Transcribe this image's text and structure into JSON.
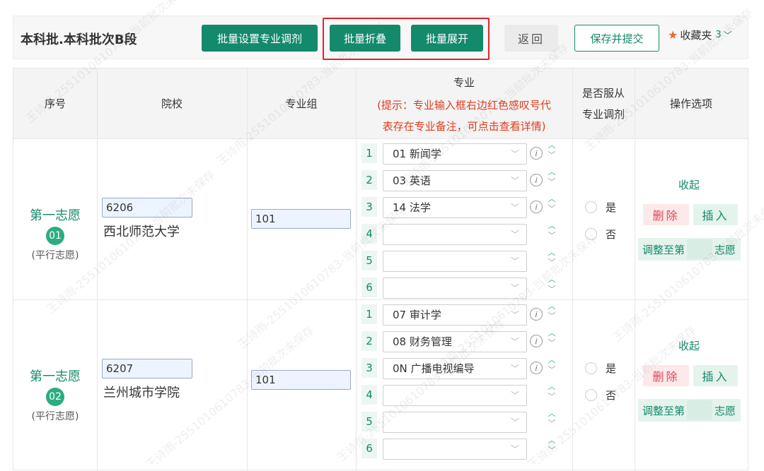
{
  "header": {
    "title": "本科批.本科批次B段",
    "batch_adjust": "批量设置专业调剂",
    "batch_collapse": "批量折叠",
    "batch_expand": "批量展开",
    "back": "返回",
    "save_submit": "保存并提交",
    "favorites": "收藏夹",
    "favorites_count": "3"
  },
  "columns": {
    "seq": "序号",
    "school": "院校",
    "group": "专业组",
    "major": "专业",
    "major_hint": "(提示：专业输入框右边红色感叹号代表存在专业备注，可点击查看详情)",
    "major_hint_line1": "(提示：专业输入框右边红色感叹号代",
    "major_hint_line2": "表存在专业备注，可点击查看详情)",
    "obey_line1": "是否服从",
    "obey_line2": "专业调剂",
    "ops": "操作选项"
  },
  "rows": [
    {
      "choice": "第一志愿",
      "num": "01",
      "type": "(平行志愿)",
      "school_code": "6206",
      "school_name": "西北师范大学",
      "group_code": "101",
      "majors": [
        "01 新闻学",
        "03 英语",
        "14 法学",
        "",
        "",
        ""
      ],
      "yes": "是",
      "no": "否",
      "collapse": "收起",
      "delete": "删除",
      "insert": "插入",
      "adjust_prefix": "调整至第",
      "adjust_suffix": "志愿"
    },
    {
      "choice": "第一志愿",
      "num": "02",
      "type": "(平行志愿)",
      "school_code": "6207",
      "school_name": "兰州城市学院",
      "group_code": "101",
      "majors": [
        "07 审计学",
        "08 财务管理",
        "0N 广播电视编导",
        "",
        "",
        ""
      ],
      "yes": "是",
      "no": "否",
      "collapse": "收起",
      "delete": "删除",
      "insert": "插入",
      "adjust_prefix": "调整至第",
      "adjust_suffix": "志愿"
    }
  ],
  "watermark": "王诗雨-2551010610783-当前批次未保存",
  "colors": {
    "accent": "#138a6c",
    "hint": "#e13b1f",
    "delete": "#e0455b",
    "highlight_box": "#e0242a"
  }
}
